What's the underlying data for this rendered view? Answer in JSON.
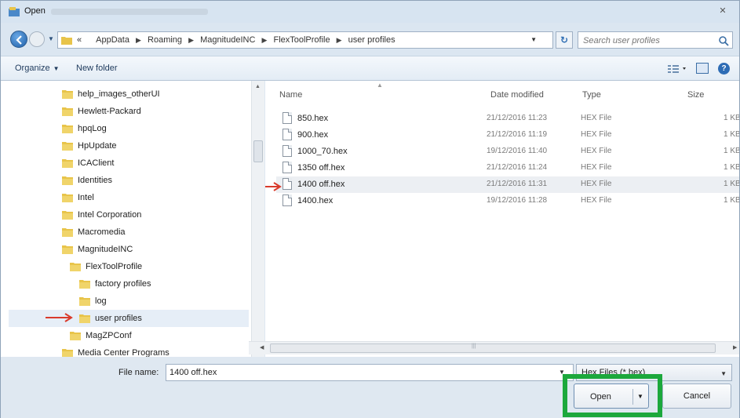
{
  "window": {
    "title": "Open",
    "close_glyph": "✕"
  },
  "address": {
    "overflow": "«",
    "crumbs": [
      "AppData",
      "Roaming",
      "MagnitudeINC",
      "FlexToolProfile",
      "user profiles"
    ],
    "refresh_glyph": "↻"
  },
  "search": {
    "placeholder": "Search user profiles"
  },
  "toolbar": {
    "organize_label": "Organize",
    "new_folder_label": "New folder",
    "help_glyph": "?"
  },
  "nav": {
    "items": [
      {
        "label": "help_images_otherUI"
      },
      {
        "label": "Hewlett-Packard"
      },
      {
        "label": "hpqLog"
      },
      {
        "label": "HpUpdate"
      },
      {
        "label": "ICAClient"
      },
      {
        "label": "Identities"
      },
      {
        "label": "Intel"
      },
      {
        "label": "Intel Corporation"
      },
      {
        "label": "Macromedia"
      },
      {
        "label": "MagnitudeINC"
      },
      {
        "label": "FlexToolProfile"
      },
      {
        "label": "factory profiles"
      },
      {
        "label": "log"
      },
      {
        "label": "user profiles"
      },
      {
        "label": "MagZPConf"
      },
      {
        "label": "Media Center Programs"
      }
    ]
  },
  "files": {
    "columns": {
      "name": "Name",
      "date": "Date modified",
      "type": "Type",
      "size": "Size"
    },
    "rows": [
      {
        "name": "850.hex",
        "date": "21/12/2016 11:23",
        "type": "HEX File",
        "size": "1 KB"
      },
      {
        "name": "900.hex",
        "date": "21/12/2016 11:19",
        "type": "HEX File",
        "size": "1 KB"
      },
      {
        "name": "1000_70.hex",
        "date": "19/12/2016 11:40",
        "type": "HEX File",
        "size": "1 KB"
      },
      {
        "name": "1350 off.hex",
        "date": "21/12/2016 11:24",
        "type": "HEX File",
        "size": "1 KB"
      },
      {
        "name": "1400 off.hex",
        "date": "21/12/2016 11:31",
        "type": "HEX File",
        "size": "1 KB"
      },
      {
        "name": "1400.hex",
        "date": "19/12/2016 11:28",
        "type": "HEX File",
        "size": "1 KB"
      }
    ]
  },
  "bottom": {
    "filename_label": "File name:",
    "filename_value": "1400 off.hex",
    "filter_value": "Hex Files (*.hex)",
    "open_label": "Open",
    "cancel_label": "Cancel"
  },
  "colors": {
    "highlight_box": "#1ca83c",
    "annotation_arrow": "#d93a2b",
    "folder_yellow": "#e8c44a"
  }
}
